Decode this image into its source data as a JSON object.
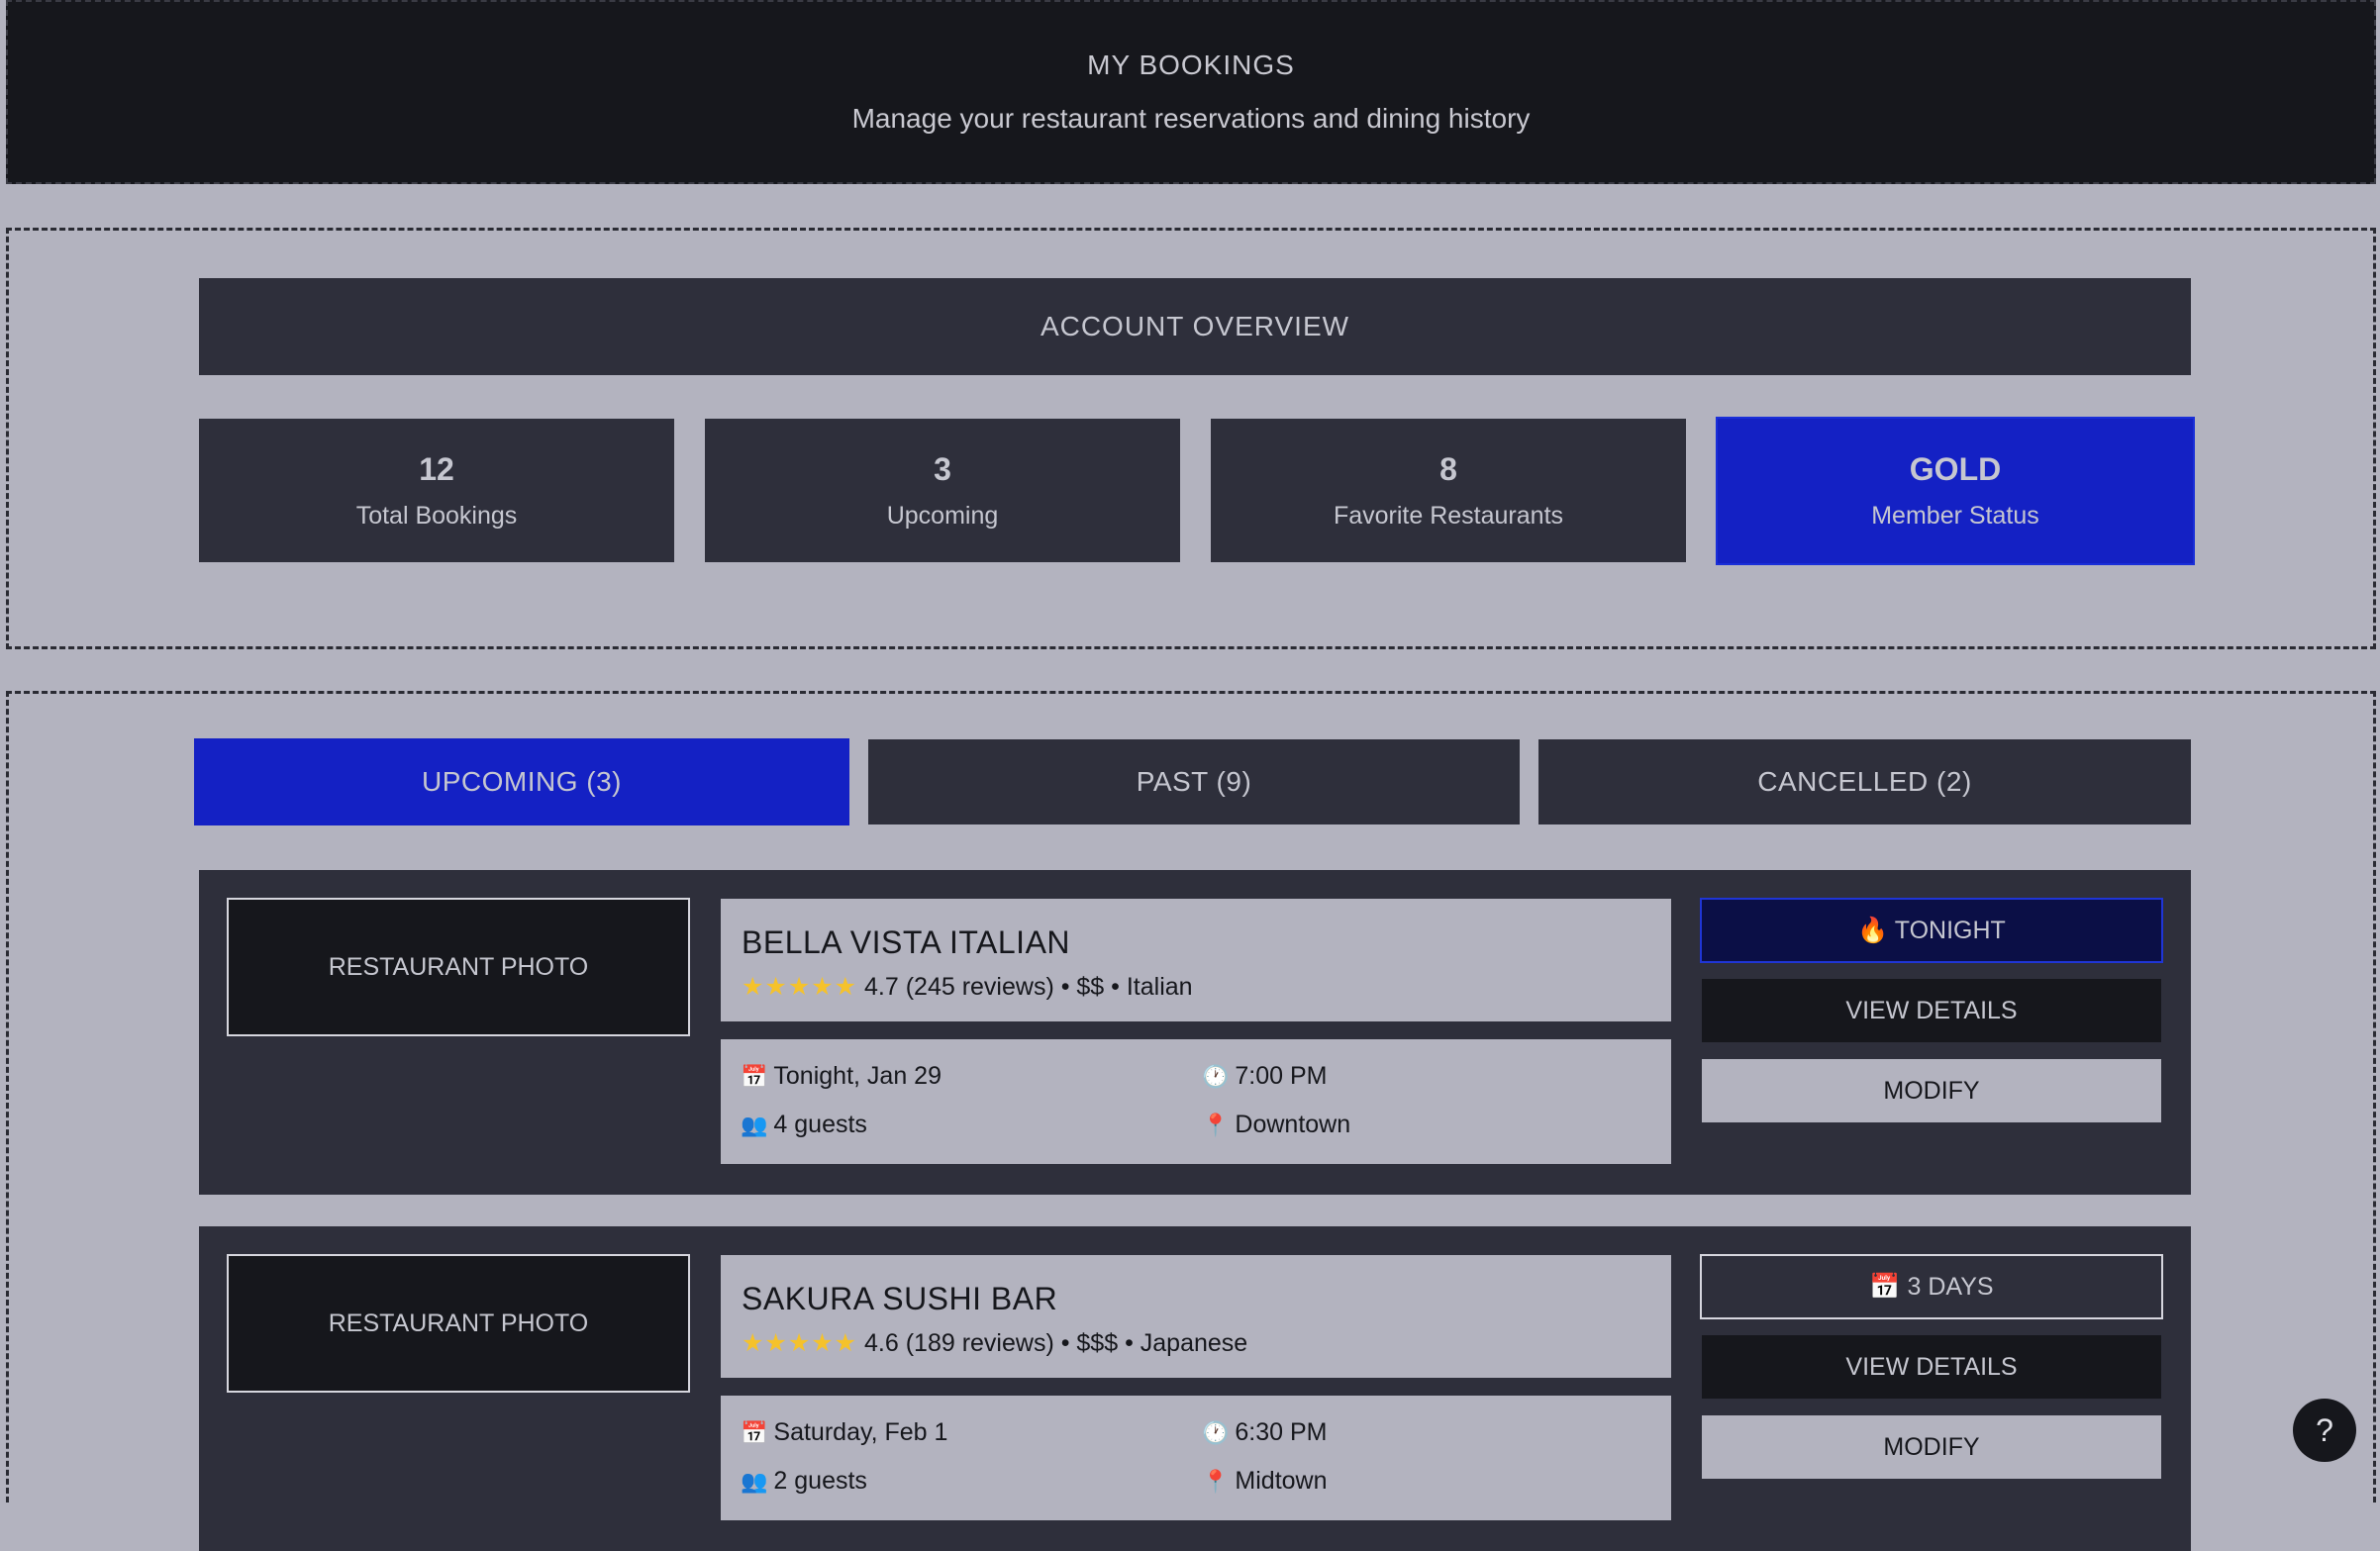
{
  "header": {
    "title": "MY BOOKINGS",
    "subtitle": "Manage your restaurant reservations and dining history"
  },
  "overview": {
    "title": "ACCOUNT OVERVIEW",
    "stats": [
      {
        "value": "12",
        "label": "Total Bookings"
      },
      {
        "value": "3",
        "label": "Upcoming"
      },
      {
        "value": "8",
        "label": "Favorite Restaurants"
      },
      {
        "value": "GOLD",
        "label": "Member Status"
      }
    ]
  },
  "tabs": [
    {
      "label": "UPCOMING (3)",
      "active": true
    },
    {
      "label": "PAST (9)",
      "active": false
    },
    {
      "label": "CANCELLED (2)",
      "active": false
    }
  ],
  "bookings": [
    {
      "photo_label": "RESTAURANT PHOTO",
      "name": "BELLA VISTA ITALIAN",
      "stars": "★★★★★",
      "meta": "4.7 (245 reviews) • $$ • Italian",
      "date": "Tonight, Jan 29",
      "time": "7:00 PM",
      "guests": "4 guests",
      "location": "Downtown",
      "badge": "🔥 TONIGHT",
      "view_label": "VIEW DETAILS",
      "modify_label": "MODIFY"
    },
    {
      "photo_label": "RESTAURANT PHOTO",
      "name": "SAKURA SUSHI BAR",
      "stars": "★★★★★",
      "meta": "4.6 (189 reviews) • $$$ • Japanese",
      "date": "Saturday, Feb 1",
      "time": "6:30 PM",
      "guests": "2 guests",
      "location": "Midtown",
      "badge": "📅 3 DAYS",
      "view_label": "VIEW DETAILS",
      "modify_label": "MODIFY"
    }
  ],
  "icons": {
    "calendar": "📅",
    "clock": "🕐",
    "guests": "👥",
    "pin": "📍",
    "help": "?"
  },
  "colors": {
    "accent": "#1421c4",
    "dark": "#16171c",
    "panel": "#2e2f3b",
    "page": "#b3b3bf"
  }
}
